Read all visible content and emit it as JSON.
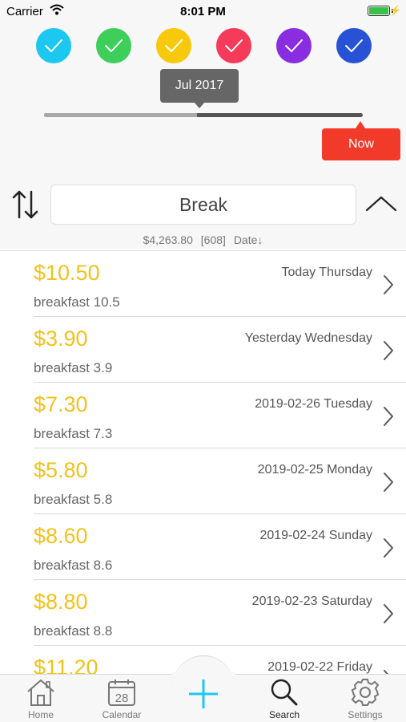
{
  "status_bar": {
    "carrier": "Carrier",
    "time": "8:01 PM"
  },
  "colors": [
    {
      "name": "cyan",
      "hex": "#1cc8f0"
    },
    {
      "name": "green",
      "hex": "#3dcf5a"
    },
    {
      "name": "yellow",
      "hex": "#f8c80d"
    },
    {
      "name": "red",
      "hex": "#f53a5a"
    },
    {
      "name": "purple",
      "hex": "#8a2ce0"
    },
    {
      "name": "blue",
      "hex": "#2752d6"
    }
  ],
  "date_slider": {
    "tooltip": "Jul 2017",
    "now_label": "Now",
    "position_fraction": 0.48
  },
  "search": {
    "query": "Break"
  },
  "summary": {
    "total": "$4,263.80",
    "count": "[608]",
    "sort": "Date↓"
  },
  "entries": [
    {
      "amount": "$10.50",
      "date": "Today Thursday",
      "note": "breakfast 10.5"
    },
    {
      "amount": "$3.90",
      "date": "Yesterday Wednesday",
      "note": "breakfast 3.9"
    },
    {
      "amount": "$7.30",
      "date": "2019-02-26 Tuesday",
      "note": "breakfast 7.3"
    },
    {
      "amount": "$5.80",
      "date": "2019-02-25 Monday",
      "note": "breakfast 5.8"
    },
    {
      "amount": "$8.60",
      "date": "2019-02-24 Sunday",
      "note": "breakfast 8.6"
    },
    {
      "amount": "$8.80",
      "date": "2019-02-23 Saturday",
      "note": "breakfast 8.8"
    },
    {
      "amount": "$11.20",
      "date": "2019-02-22 Friday",
      "note": ""
    }
  ],
  "tabs": [
    {
      "label": "Home",
      "icon": "house-icon"
    },
    {
      "label": "Calendar",
      "icon": "calendar-icon",
      "day": "28"
    },
    {
      "label": "",
      "icon": "plus-icon"
    },
    {
      "label": "Search",
      "icon": "magnifier-icon"
    },
    {
      "label": "Settings",
      "icon": "gear-icon"
    }
  ],
  "accent_colors": {
    "amount": "#f1c21b",
    "now_button": "#f23a2a",
    "add_button": "#1cc8f0"
  }
}
